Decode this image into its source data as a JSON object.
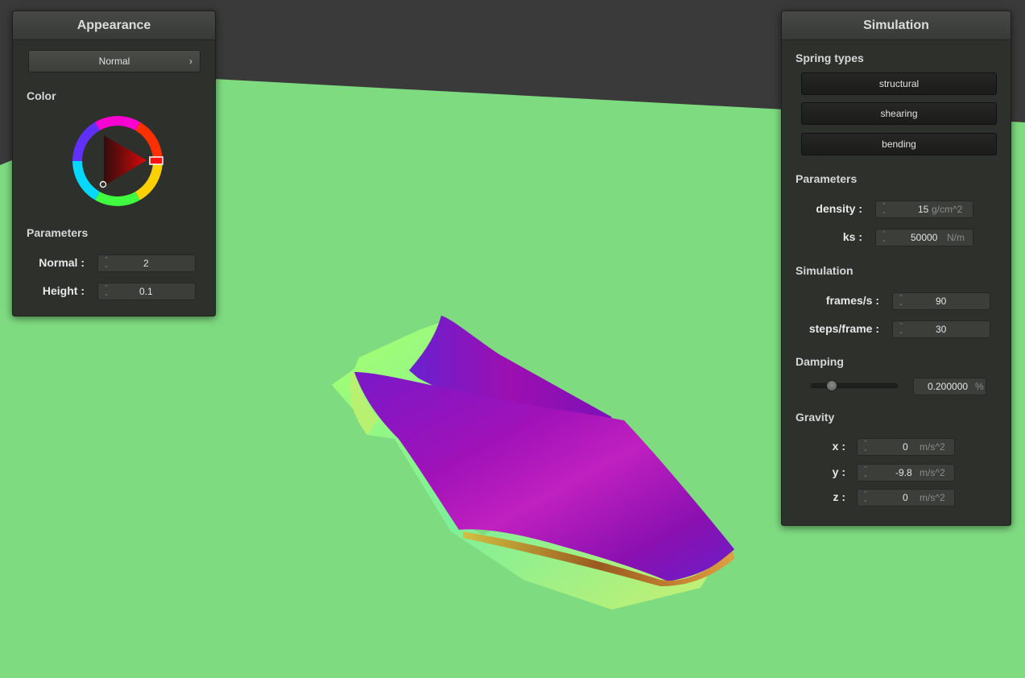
{
  "appearance": {
    "title": "Appearance",
    "mode_button": "Normal",
    "color_label": "Color",
    "picked_color": "#ff0000",
    "parameters_label": "Parameters",
    "normal": {
      "label": "Normal :",
      "value": "2"
    },
    "height": {
      "label": "Height :",
      "value": "0.1"
    }
  },
  "simulation": {
    "title": "Simulation",
    "spring_types_label": "Spring types",
    "spring_types": [
      "structural",
      "shearing",
      "bending"
    ],
    "parameters_label": "Parameters",
    "density": {
      "label": "density :",
      "value": "15",
      "unit": "g/cm^2"
    },
    "ks": {
      "label": "ks :",
      "value": "50000",
      "unit": "N/m"
    },
    "simulation_label": "Simulation",
    "fps": {
      "label": "frames/s :",
      "value": "90"
    },
    "steps": {
      "label": "steps/frame :",
      "value": "30"
    },
    "damping_label": "Damping",
    "damping": {
      "value": "0.200000",
      "unit": "%",
      "fraction": 0.2
    },
    "gravity_label": "Gravity",
    "gravity": [
      {
        "label": "x :",
        "value": "0",
        "unit": "m/s^2"
      },
      {
        "label": "y :",
        "value": "-9.8",
        "unit": "m/s^2"
      },
      {
        "label": "z :",
        "value": "0",
        "unit": "m/s^2"
      }
    ]
  },
  "colors": {
    "background": "#7fdb80",
    "cloth_main": "#8a0fb0",
    "cloth_underside": "#8cf87a",
    "panel": "#2e302c"
  }
}
